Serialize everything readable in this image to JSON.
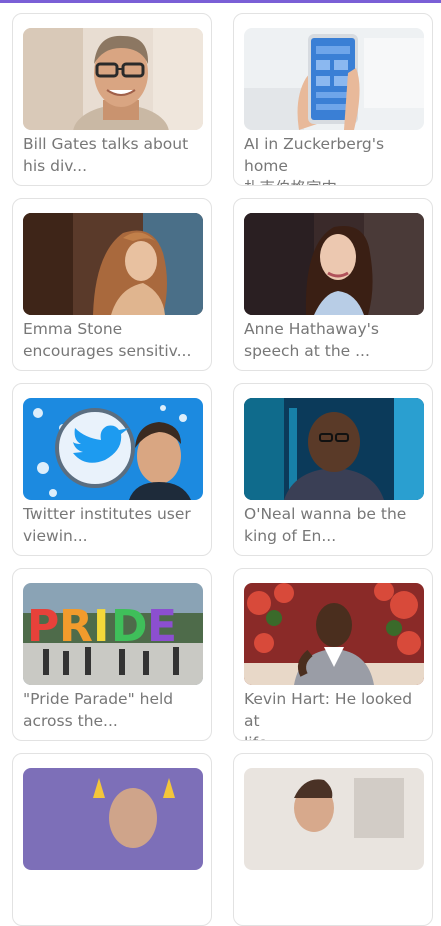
{
  "colors": {
    "accent_bar": "#7a5fd6",
    "caption_text": "#777777",
    "card_border": "#e2e2e2"
  },
  "cards": [
    {
      "caption": "Bill Gates talks about\nhis div...",
      "image": "portrait-man-glasses-sweater"
    },
    {
      "caption": "AI in Zuckerberg's home\n扎克伯格家中...",
      "image": "hand-holding-smartphone-app"
    },
    {
      "caption": "Emma Stone\nencourages sensitiv...",
      "image": "woman-long-hair-profile"
    },
    {
      "caption": "Anne Hathaway's\nspeech at the ...",
      "image": "woman-dark-hair-gown"
    },
    {
      "caption": "Twitter institutes user\nviewin...",
      "image": "twitter-bird-logo-with-man"
    },
    {
      "caption": "O'Neal wanna be the\nking of En...",
      "image": "smiling-bald-man-stage"
    },
    {
      "caption": "\"Pride Parade\" held\nacross the...",
      "image": "pride-balloon-letters-parade"
    },
    {
      "caption": "Kevin Hart: He looked at\nlife ...",
      "image": "man-on-talk-show-set"
    },
    {
      "caption": "",
      "image": "partial-thumbnail"
    },
    {
      "caption": "",
      "image": "partial-thumbnail"
    }
  ]
}
